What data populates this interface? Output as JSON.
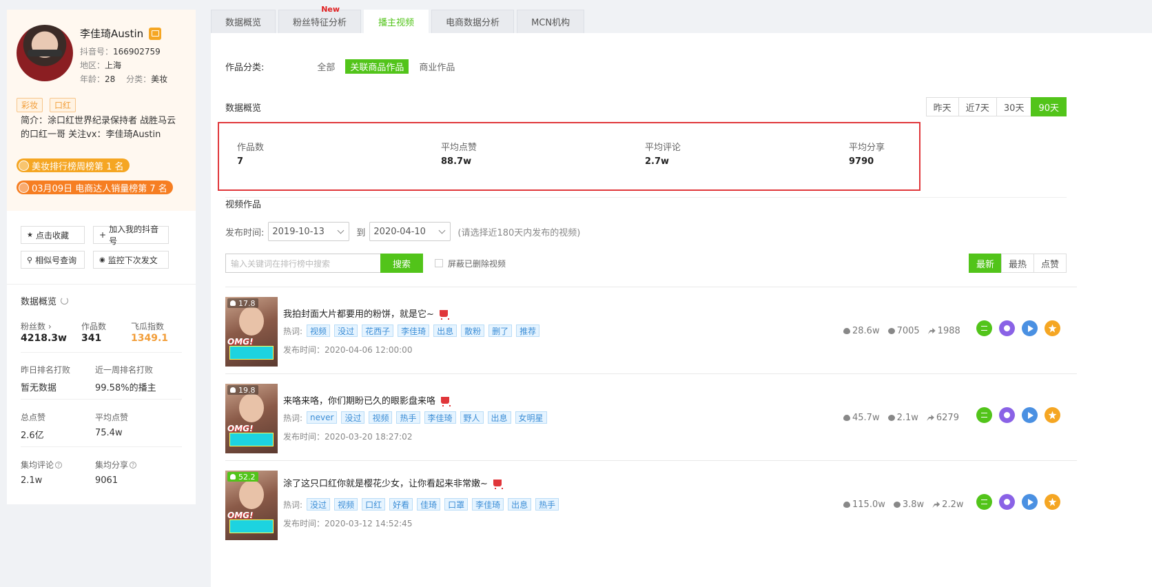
{
  "profile": {
    "name": "李佳琦Austin",
    "douyin_id_label": "抖音号：",
    "douyin_id": "166902759",
    "region_label": "地区：",
    "region": "上海",
    "age_label": "年龄：",
    "age": "28",
    "category_label": "分类：",
    "category": "美妆",
    "tags": [
      "彩妆",
      "口红"
    ],
    "bio": "简介：涂口红世界纪录保持者 战胜马云的口红一哥 关注vx：李佳琦Austin",
    "rank1": "美妆排行榜周榜第 1 名",
    "rank2": "03月09日 电商达人销量榜第 7 名"
  },
  "actions": {
    "favorite": "点击收藏",
    "add_mine": "加入我的抖音号",
    "similar": "相似号查询",
    "monitor": "监控下次发文"
  },
  "stats": {
    "title": "数据概览",
    "fans_label": "粉丝数",
    "fans": "4218.3w",
    "works_label": "作品数",
    "works": "341",
    "index_label": "飞瓜指数",
    "index": "1349.1",
    "yesterday_rank_label": "昨日排名打败",
    "yesterday_rank": "暂无数据",
    "week_rank_label": "近一周排名打败",
    "week_rank": "99.58%的播主",
    "total_likes_label": "总点赞",
    "total_likes": "2.6亿",
    "avg_likes_label": "平均点赞",
    "avg_likes": "75.4w",
    "avg_comments_label": "集均评论",
    "avg_comments": "2.1w",
    "avg_shares_label": "集均分享",
    "avg_shares": "9061"
  },
  "tabs": [
    "数据概览",
    "粉丝特征分析",
    "播主视频",
    "电商数据分析",
    "MCN机构"
  ],
  "new_badge": "New",
  "category_filter": {
    "label": "作品分类:",
    "options": [
      "全部",
      "关联商品作品",
      "商业作品"
    ]
  },
  "overview": {
    "title": "数据概览",
    "ranges": [
      "昨天",
      "近7天",
      "30天",
      "90天"
    ],
    "works_label": "作品数",
    "works": "7",
    "avg_likes_label": "平均点赞",
    "avg_likes": "88.7w",
    "avg_comments_label": "平均评论",
    "avg_comments": "2.7w",
    "avg_shares_label": "平均分享",
    "avg_shares": "9790"
  },
  "videos_section": {
    "title": "视频作品",
    "date_label": "发布时间:",
    "start_date": "2019-10-13",
    "to_label": "到",
    "end_date": "2020-04-10",
    "hint": "(请选择近180天内发布的视频)",
    "search_placeholder": "输入关键词在排行榜中搜索",
    "search_btn": "搜索",
    "hide_deleted": "屏蔽已删除视频",
    "sorts": [
      "最新",
      "最热",
      "点赞"
    ]
  },
  "videos": [
    {
      "score": "17.8",
      "title": "我拍封面大片都要用的粉饼，就是它~",
      "hot_label": "热词:",
      "keywords": [
        "视频",
        "没过",
        "花西子",
        "李佳琦",
        "出息",
        "散粉",
        "删了",
        "推荐"
      ],
      "publish": "发布时间：2020-04-06 12:00:00",
      "likes": "28.6w",
      "comments": "7005",
      "shares": "1988"
    },
    {
      "score": "19.8",
      "title": "来咯来咯，你们期盼已久的眼影盘来咯",
      "hot_label": "热词:",
      "keywords": [
        "never",
        "没过",
        "视频",
        "热手",
        "李佳琦",
        "野人",
        "出息",
        "女明星"
      ],
      "publish": "发布时间：2020-03-20 18:27:02",
      "likes": "45.7w",
      "comments": "2.1w",
      "shares": "6279"
    },
    {
      "score": "52.2",
      "title": "涂了这只口红你就是樱花少女，让你看起来非常嫩~",
      "hot_label": "热词:",
      "keywords": [
        "没过",
        "视频",
        "口红",
        "好看",
        "佳琦",
        "口罩",
        "李佳琦",
        "出息",
        "热手"
      ],
      "publish": "发布时间：2020-03-12 14:52:45",
      "likes": "115.0w",
      "comments": "3.8w",
      "shares": "2.2w"
    }
  ]
}
